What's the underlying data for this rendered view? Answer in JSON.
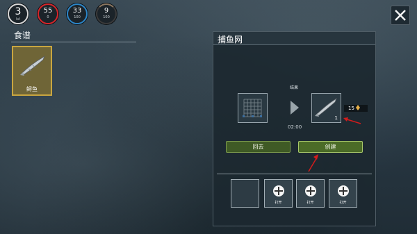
{
  "hud": {
    "level": {
      "value": "3",
      "sub": "lvl"
    },
    "health": {
      "value": "55",
      "sub": "0",
      "color": "#d7262b"
    },
    "water": {
      "value": "33",
      "sub": "100",
      "color": "#2d86c8"
    },
    "food": {
      "value": "9",
      "sub": "100",
      "color": "#8a7660"
    }
  },
  "recipes": {
    "title": "食谱",
    "items": [
      {
        "label": "鲟鱼",
        "icon": "sturgeon-fish-icon"
      }
    ]
  },
  "craft": {
    "title": "捕鱼网",
    "result_label": "结果",
    "input_icon": "fishing-net-icon",
    "output_icon": "sturgeon-fish-icon",
    "output_count": "1",
    "time": "02:00",
    "xp": "15",
    "back_label": "回去",
    "create_label": "创建",
    "slots": [
      {
        "empty": true,
        "label": ""
      },
      {
        "empty": false,
        "label": "打开"
      },
      {
        "empty": false,
        "label": "打开"
      },
      {
        "empty": false,
        "label": "打开"
      }
    ]
  },
  "accent": {
    "panel_border": "#c9a640",
    "button_green": "#4b6b27"
  }
}
